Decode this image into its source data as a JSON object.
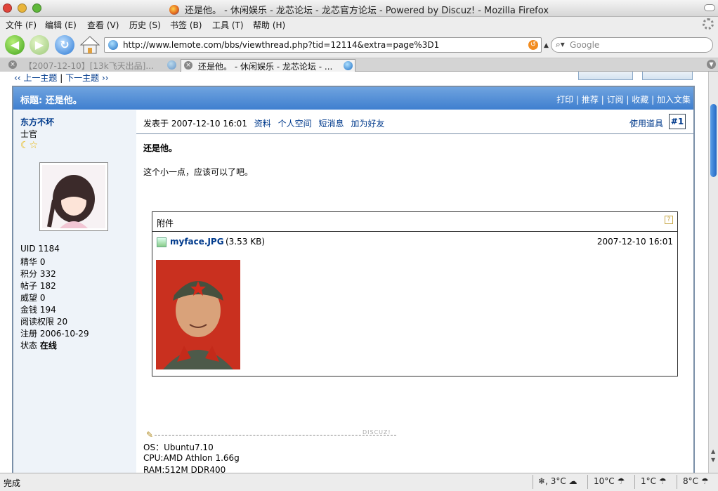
{
  "window": {
    "title": "还是他。 - 休闲娱乐 - 龙芯论坛 - 龙芯官方论坛 - Powered by Discuz! - Mozilla Firefox"
  },
  "menubar": {
    "items": [
      "文件 (F)",
      "编辑 (E)",
      "查看 (V)",
      "历史 (S)",
      "书签 (B)",
      "工具 (T)",
      "帮助 (H)"
    ]
  },
  "navbar": {
    "url": "http://www.lemote.com/bbs/viewthread.php?tid=12114&extra=page%3D1",
    "search_placeholder": "Google"
  },
  "tabs": [
    {
      "label": "【2007-12-10】[13k飞天出品]...",
      "active": false
    },
    {
      "label": "还是他。 - 休闲娱乐 - 龙芯论坛 - ...",
      "active": true
    }
  ],
  "page": {
    "prev_topic": "‹‹ 上一主题",
    "next_topic": "下一主题 ››",
    "thread_title": "标题: 还是他。",
    "header_links": [
      "打印",
      "推荐",
      "订阅",
      "收藏",
      "加入文集"
    ],
    "user": {
      "name": "东方不坏",
      "rank": "士官",
      "stats": [
        {
          "label": "UID",
          "value": "1184"
        },
        {
          "label": "精华",
          "value": "0"
        },
        {
          "label": "积分",
          "value": "332"
        },
        {
          "label": "帖子",
          "value": "182"
        },
        {
          "label": "威望",
          "value": "0"
        },
        {
          "label": "金钱",
          "value": "194"
        },
        {
          "label": "阅读权限",
          "value": "20"
        },
        {
          "label": "注册",
          "value": "2006-10-29"
        }
      ],
      "status_label": "状态",
      "status_value": "在线"
    },
    "post": {
      "posted_at": "发表于 2007-12-10 16:01",
      "links": [
        "资料",
        "个人空间",
        "短消息",
        "加为好友"
      ],
      "use_props": "使用道具",
      "floor": "#1",
      "title": "还是他。",
      "body": "这个小一点，应该可以了吧。"
    },
    "attachment": {
      "label": "附件",
      "filename": "myface.JPG",
      "size": "(3.53 KB)",
      "date": "2007-12-10 16:01"
    },
    "signature": {
      "mark": "DISCUZ!",
      "lines": [
        "OS：Ubuntu7.10",
        "CPU:AMD Athlon 1.66g",
        "RAM:512M DDR400"
      ]
    }
  },
  "status": {
    "text": "完成",
    "weather": [
      "3°C",
      "10°C",
      "1°C",
      "8°C"
    ]
  },
  "colors": {
    "header_blue": "#3f7fcf",
    "link": "#003a8c",
    "left_panel": "#eef3f9"
  }
}
